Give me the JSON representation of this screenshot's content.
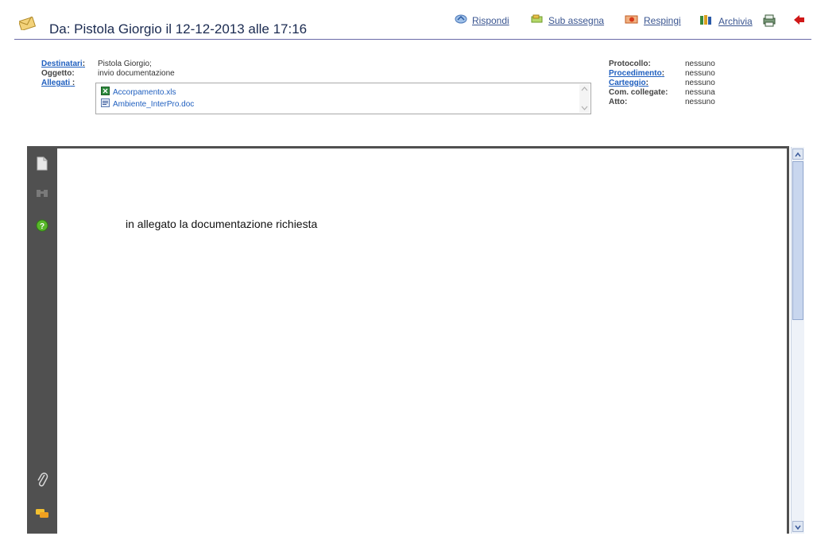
{
  "header": {
    "title": "Da: Pistola Giorgio il 12-12-2013 alle 17:16"
  },
  "actions": {
    "reply": "Rispondi",
    "sub_assign": "Sub assegna",
    "reject": "Respingi",
    "archive": "Archivia"
  },
  "meta_left": {
    "recipients_label": "Destinatari",
    "recipients_value": "Pistola Giorgio;",
    "subject_label": "Oggetto:",
    "subject_value": "invio documentazione",
    "attachments_label": "Allegati",
    "attachments": [
      {
        "name": "Accorpamento.xls",
        "icon": "excel-file-icon"
      },
      {
        "name": "Ambiente_InterPro.doc",
        "icon": "word-file-icon"
      }
    ]
  },
  "meta_right": {
    "protocol_label": "Protocollo:",
    "protocol_value": "nessuno",
    "procedure_label": "Procedimento",
    "procedure_value": "nessuno",
    "file_label": "Carteggio",
    "file_value": "nessuno",
    "linked_label": "Com. collegate:",
    "linked_value": "nessuna",
    "act_label": "Atto:",
    "act_value": "nessuno"
  },
  "document": {
    "body": "in allegato la documentazione richiesta"
  },
  "colors": {
    "accent": "#1f5fbf",
    "viewer_bg": "#505050",
    "title_rule": "#6a6aa8"
  }
}
